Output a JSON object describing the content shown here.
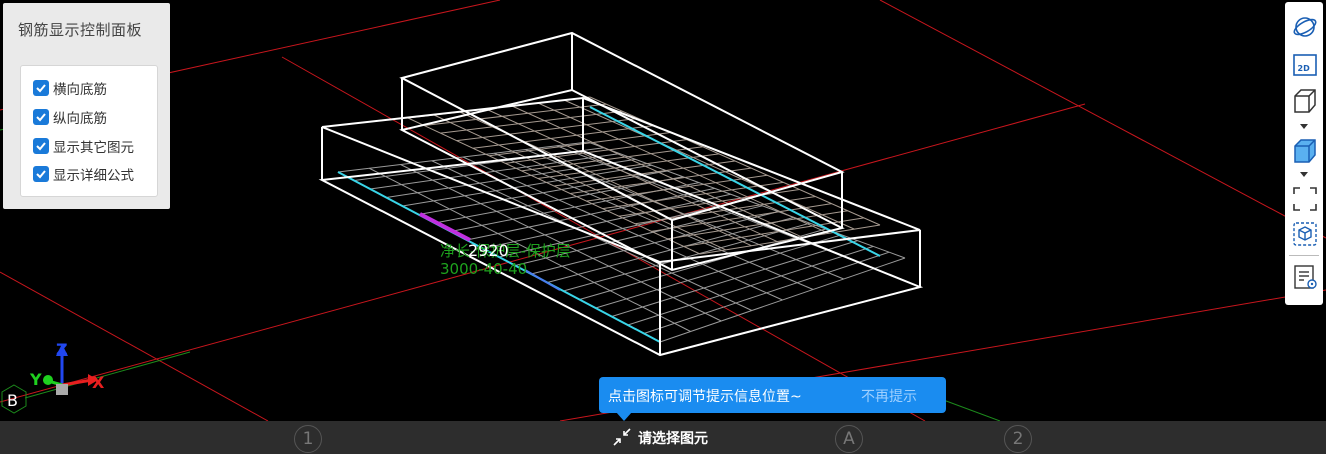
{
  "panel": {
    "title": "钢筋显示控制面板",
    "options": [
      {
        "label": "横向底筋",
        "checked": true
      },
      {
        "label": "纵向底筋",
        "checked": true
      },
      {
        "label": "显示其它图元",
        "checked": true
      },
      {
        "label": "显示详细公式",
        "checked": true
      }
    ]
  },
  "toolbar": {
    "icons": [
      "orbit-icon",
      "2d-view-icon",
      "wireframe-cube-icon",
      "solid-cube-icon",
      "fullscreen-icon",
      "view-cube-icon",
      "properties-icon"
    ],
    "label_2d": "2D"
  },
  "viewport": {
    "dimension_value": "2920",
    "annotation_line1": "净长-保护层-保护层",
    "annotation_line2": "3000-40-40",
    "axis_x": "X",
    "axis_y": "Y",
    "axis_z": "Z",
    "grid_label_b": "B",
    "colors": {
      "grid_line": "#c8161d",
      "wireframe": "#ffffff",
      "rebar": "#9a9a9a",
      "highlight_rebar": "#39d5e8",
      "annotation": "#1ea21e"
    }
  },
  "tooltip": {
    "message": "点击图标可调节提示信息位置~",
    "dismiss": "不再提示"
  },
  "statusbar": {
    "prompt": "请选择图元",
    "axis_labels": [
      "1",
      "A",
      "2"
    ]
  }
}
